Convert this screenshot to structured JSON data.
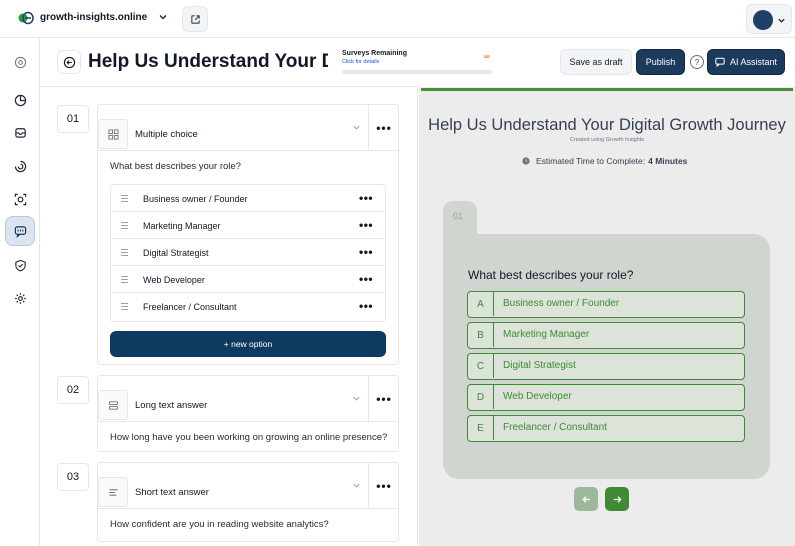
{
  "workspace": {
    "name": "growth-insights.online"
  },
  "header": {
    "title": "Help Us Understand Your Digit",
    "surveys_label": "Surveys Remaining",
    "surveys_link": "Click for details",
    "surveys_count": "∞",
    "save_draft": "Save as draft",
    "publish": "Publish",
    "help": "?",
    "ai_assistant": "AI Assistant"
  },
  "questions": [
    {
      "number": "01",
      "type": "Multiple choice",
      "text": "What best describes your role?",
      "options": [
        "Business owner / Founder",
        "Marketing Manager",
        "Digital Strategist",
        "Web Developer",
        "Freelancer / Consultant"
      ],
      "new_option": "+ new option"
    },
    {
      "number": "02",
      "type": "Long text answer",
      "text": "How long have you been working on growing an online presence?"
    },
    {
      "number": "03",
      "type": "Short text answer",
      "text": "How confident are you in reading website analytics?"
    }
  ],
  "preview": {
    "title": "Help Us Understand Your Digital Growth Journey",
    "created": "Created using Growth Insights",
    "time_label": "Estimated Time to Complete:",
    "time_value": "4 Minutes",
    "question_number": "01",
    "question": "What best describes your role?",
    "options": [
      {
        "letter": "A",
        "label": "Business owner / Founder"
      },
      {
        "letter": "B",
        "label": "Marketing Manager"
      },
      {
        "letter": "C",
        "label": "Digital Strategist"
      },
      {
        "letter": "D",
        "label": "Web Developer"
      },
      {
        "letter": "E",
        "label": "Freelancer / Consultant"
      }
    ],
    "accent_color": "#3f8a35"
  },
  "colors": {
    "primary": "#1b3a5c",
    "preview_green": "#3f8a35"
  }
}
